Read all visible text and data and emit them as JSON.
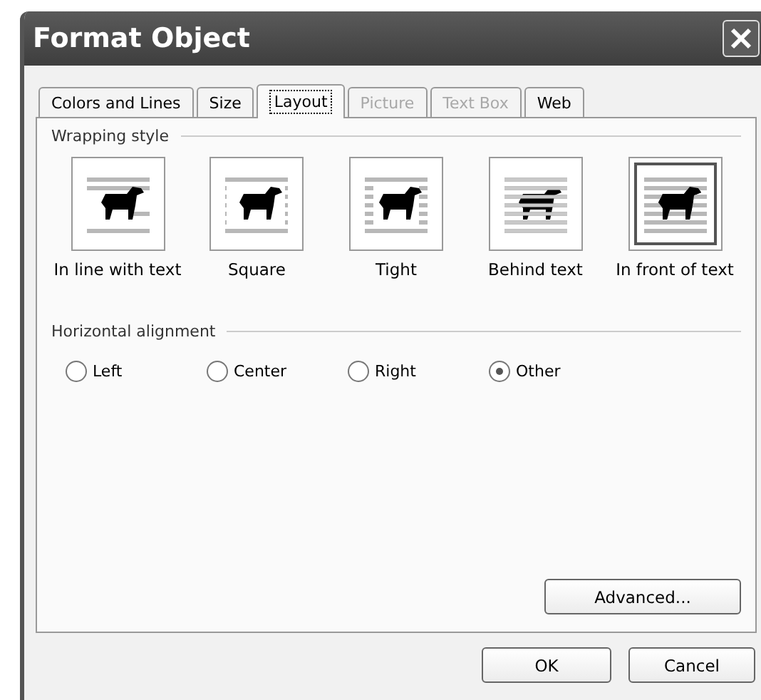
{
  "window": {
    "title": "Format Object"
  },
  "tabs": [
    {
      "label": "Colors and Lines",
      "selected": false,
      "disabled": false
    },
    {
      "label": "Size",
      "selected": false,
      "disabled": false
    },
    {
      "label": "Layout",
      "selected": true,
      "disabled": false
    },
    {
      "label": "Picture",
      "selected": false,
      "disabled": true
    },
    {
      "label": "Text Box",
      "selected": false,
      "disabled": true
    },
    {
      "label": "Web",
      "selected": false,
      "disabled": false
    }
  ],
  "wrapping_style": {
    "heading": "Wrapping style",
    "options": [
      {
        "label": "In line with text",
        "kind": "inline",
        "selected": false
      },
      {
        "label": "Square",
        "kind": "square",
        "selected": false
      },
      {
        "label": "Tight",
        "kind": "tight",
        "selected": false
      },
      {
        "label": "Behind text",
        "kind": "behind",
        "selected": false
      },
      {
        "label": "In front of text",
        "kind": "front",
        "selected": true
      }
    ]
  },
  "horizontal_alignment": {
    "heading": "Horizontal alignment",
    "options": [
      {
        "label": "Left",
        "selected": false
      },
      {
        "label": "Center",
        "selected": false
      },
      {
        "label": "Right",
        "selected": false
      },
      {
        "label": "Other",
        "selected": true
      }
    ]
  },
  "advanced_button": "Advanced...",
  "buttons": [
    "OK",
    "Cancel"
  ]
}
